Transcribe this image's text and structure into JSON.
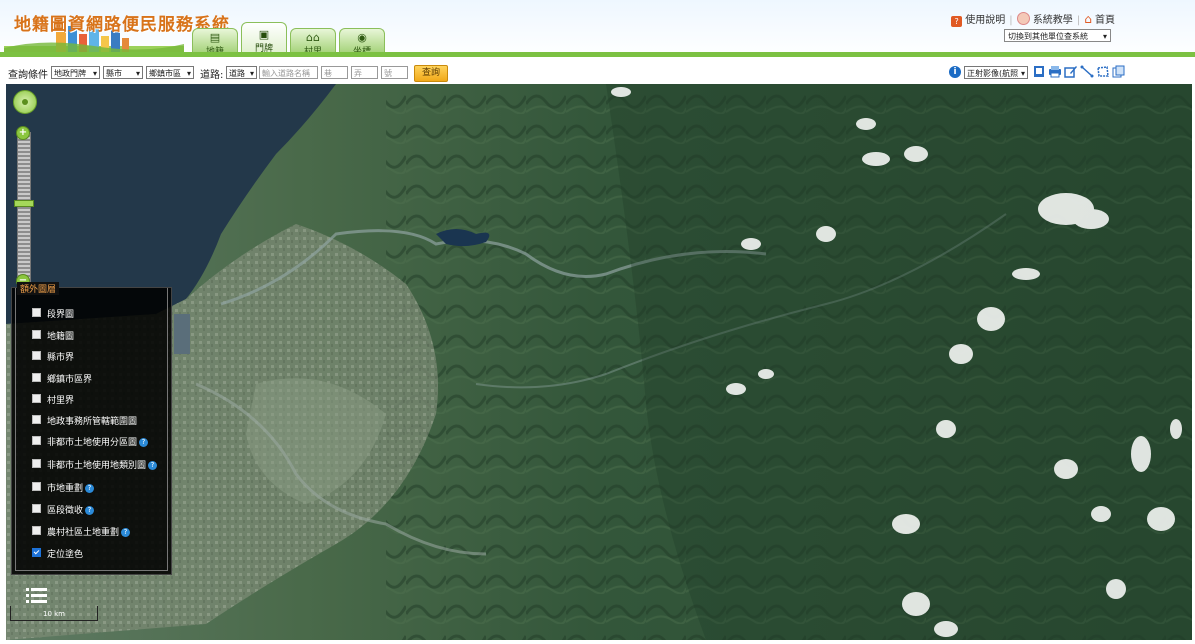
{
  "header": {
    "site_title": "地籍圖資網路便民服務系統",
    "tabs": [
      {
        "label": "地籍",
        "icon": "map-icon"
      },
      {
        "label": "門牌",
        "icon": "door-plate-icon",
        "active": true
      },
      {
        "label": "村里",
        "icon": "village-icon"
      },
      {
        "label": "坐標",
        "icon": "globe-icon"
      }
    ],
    "links": {
      "manual": "使用說明",
      "teaching": "系統教學",
      "home": "首頁"
    },
    "switch_system": "切換到其他單位查系統"
  },
  "toolbar": {
    "query_condition_label": "查詢條件",
    "type_select": "地政門牌",
    "county_select": "縣市",
    "town_select": "鄉鎮市區",
    "road_label": "道路:",
    "road_select": "道路",
    "road_placeholder": "輸入道路名稱",
    "lane_placeholder": "巷",
    "alley_placeholder": "弄",
    "number_placeholder": "號",
    "query_button": "查詢",
    "basemap_select": "正射影像(航照"
  },
  "map": {
    "layers_panel_title": "額外圖層",
    "layers": [
      {
        "label": "段界圖",
        "checked": false,
        "help": false
      },
      {
        "label": "地籍圖",
        "checked": false,
        "help": false
      },
      {
        "label": "縣市界",
        "checked": false,
        "help": false
      },
      {
        "label": "鄉鎮市區界",
        "checked": false,
        "help": false
      },
      {
        "label": "村里界",
        "checked": false,
        "help": false
      },
      {
        "label": "地政事務所管轄範圍圖",
        "checked": false,
        "help": false
      },
      {
        "label": "非都市土地使用分區圖",
        "checked": false,
        "help": true
      },
      {
        "label": "非都市土地使用地類別圖",
        "checked": false,
        "help": true
      },
      {
        "label": "市地重劃",
        "checked": false,
        "help": true
      },
      {
        "label": "區段徵收",
        "checked": false,
        "help": true
      },
      {
        "label": "農村社區土地重劃",
        "checked": false,
        "help": true
      },
      {
        "label": "定位塗色",
        "checked": true,
        "help": false
      }
    ],
    "scale_label": "10 km"
  },
  "colors": {
    "accent_green": "#7cc142",
    "title_orange": "#d8731a",
    "query_button": "#f1a91a",
    "checkbox_on": "#1d72d8"
  }
}
